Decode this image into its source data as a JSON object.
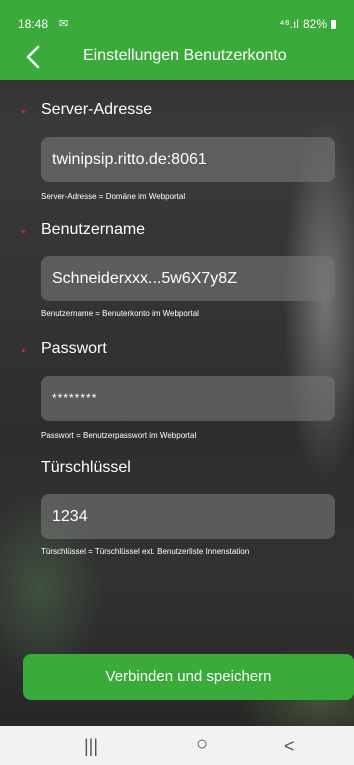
{
  "status_bar": {
    "time": "18:48",
    "mail_icon": "mail-icon",
    "network": "⁴⁸.ıl",
    "battery": "82%"
  },
  "app_bar": {
    "title": "Einstellungen Benutzerkonto",
    "back_icon": "chevron-left-icon",
    "background": "#3aaa3a"
  },
  "form": {
    "required_mark": "*",
    "server": {
      "label": "Server-Adresse",
      "value": "twinipsip.ritto.de:8061",
      "helper": "Server-Adresse = Domäne im Webportal"
    },
    "username": {
      "label": "Benutzername",
      "value": "Schneiderxxx...5w6X7y8Z",
      "helper": "Benutzername = Benuterkonto im Webportal"
    },
    "password": {
      "label": "Passwort",
      "value": "********",
      "helper": "Passwort = Benutzerpasswort im Webportal"
    },
    "door_key": {
      "label": "Türschlüssel",
      "value": "1234",
      "helper": "Türschlüssel = Türschlüssel ext. Benutzerliste Innenstation"
    }
  },
  "actions": {
    "connect_save_label": "Verbinden und speichern",
    "accent": "#3aaa3a"
  },
  "nav_bar": {
    "recents": "|||",
    "home": "○",
    "back": "<"
  }
}
